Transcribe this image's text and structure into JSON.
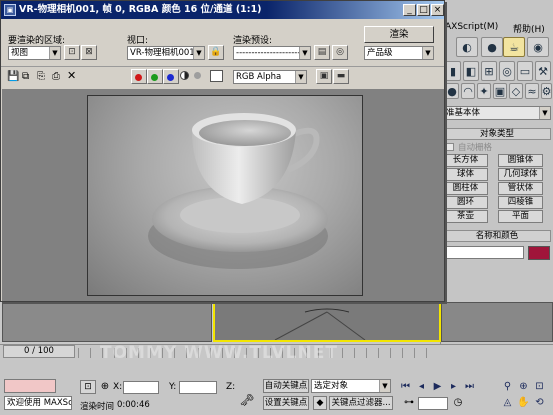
{
  "render_frame": {
    "title": "VR-物理相机001, 帧 0, RGBA 颜色 16 位/通道 (1:1)",
    "area_label": "要渲染的区域:",
    "area_value": "视图",
    "viewport_label": "视口:",
    "viewport_value": "VR-物理相机001",
    "preset_label": "渲染预设:",
    "preset_value": "------------------------",
    "render_button": "渲染",
    "product_value": "产品级",
    "channel_value": "RGB Alpha"
  },
  "background_app": {
    "menu_items": [
      "AXScript(M)",
      "帮助(H)"
    ],
    "object_type_header": "对象类型",
    "auto_grid_label": "自动栅格",
    "category_dropdown": "准基本体",
    "primitives": [
      "长方体",
      "圆锥体",
      "球体",
      "几何球体",
      "圆柱体",
      "管状体",
      "圆环",
      "四棱锥",
      "茶壶",
      "平面"
    ],
    "name_color_header": "名称和颜色"
  },
  "timeline": {
    "slider_text": "0 / 100"
  },
  "status_bar": {
    "welcome_text": "欢迎使用 MAXSc",
    "x_label": "X:",
    "y_label": "Y:",
    "z_label": "Z:",
    "render_time_label": "渲染时间",
    "render_time_value": "0:00:46",
    "auto_key_button": "自动关键点",
    "selected_object_value": "选定对象",
    "set_key_button": "设置关键点",
    "key_filter_button": "关键点过滤器..."
  },
  "watermark": {
    "text": "TOMMY WWW.TLVLNET"
  },
  "colors": {
    "title_bar": "#0a246a",
    "active_viewport_border": "#f2e500",
    "name_color_swatch": "#a0153a"
  }
}
